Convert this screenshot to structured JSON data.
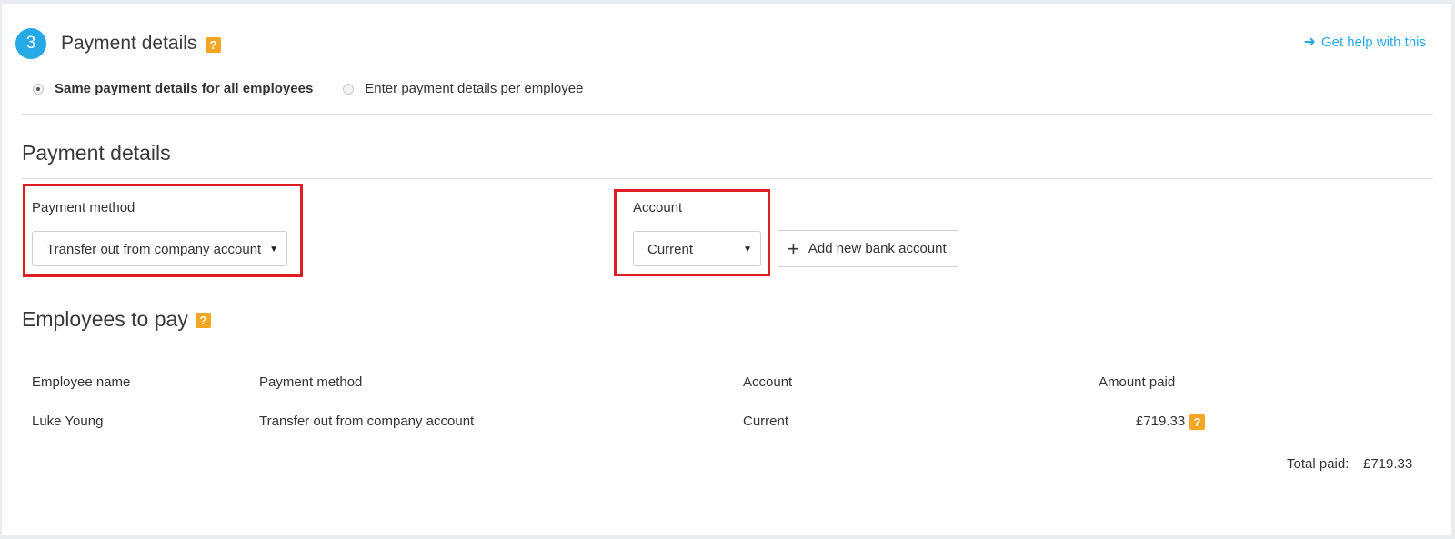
{
  "step": {
    "number": "3",
    "title": "Payment details",
    "help_icon": "?"
  },
  "help_link": {
    "icon": "arrow-right-icon",
    "label": "Get help with this"
  },
  "payment_mode": {
    "options": [
      {
        "label": "Same payment details for all employees",
        "selected": true
      },
      {
        "label": "Enter payment details per employee",
        "selected": false
      }
    ]
  },
  "payment_details": {
    "heading": "Payment details",
    "method_label": "Payment method",
    "method_value": "Transfer out from company account",
    "account_label": "Account",
    "account_value": "Current",
    "add_account_button": "Add new bank account"
  },
  "employees": {
    "heading": "Employees to pay",
    "help_icon": "?",
    "columns": [
      "Employee name",
      "Payment method",
      "Account",
      "Amount paid"
    ],
    "rows": [
      {
        "name": "Luke Young",
        "method": "Transfer out from company account",
        "account": "Current",
        "amount": "£719.33"
      }
    ],
    "total_label": "Total paid:",
    "total_value": "£719.33"
  },
  "colors": {
    "accent": "#27a9e8",
    "help_badge": "#f5a623",
    "highlight": "#e01c24"
  }
}
